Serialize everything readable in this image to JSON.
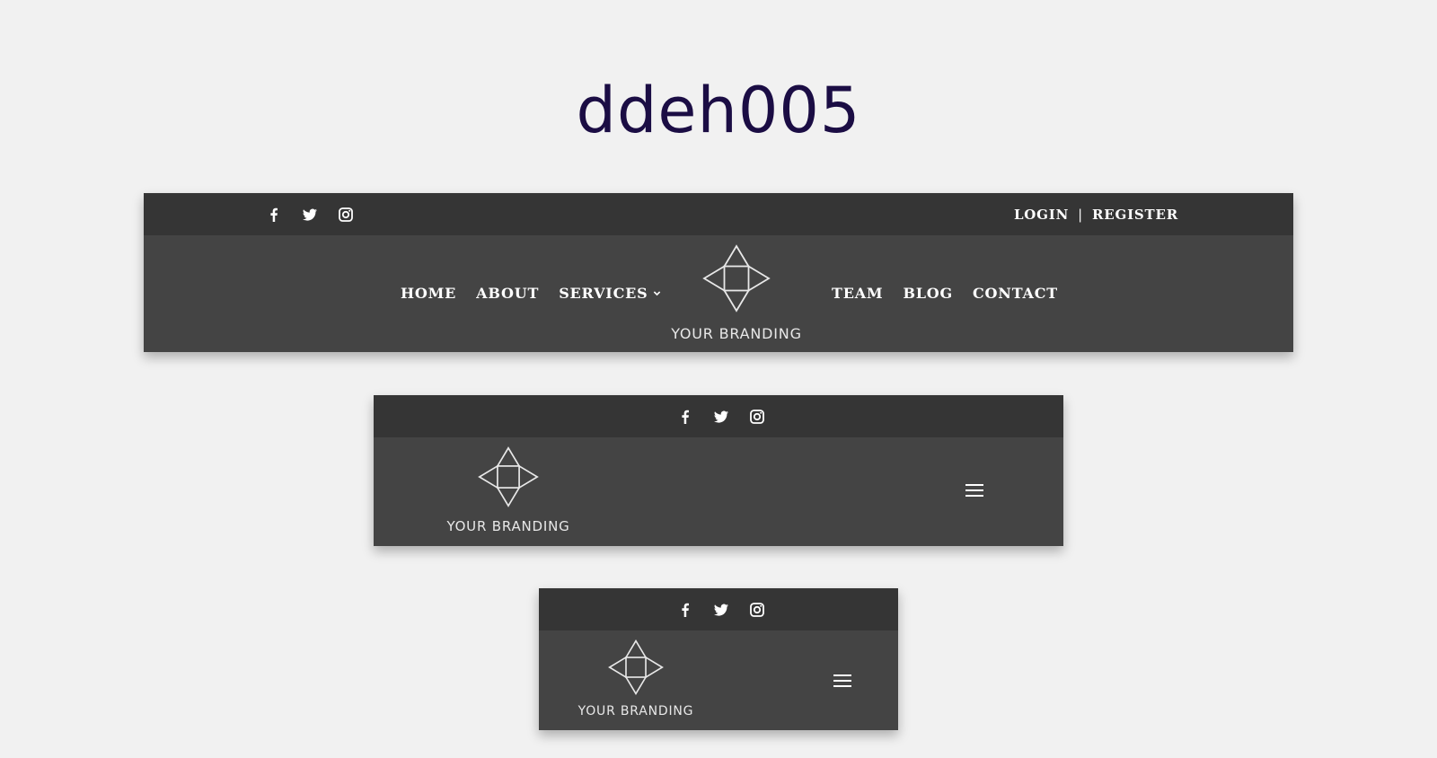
{
  "page": {
    "title": "ddeh005"
  },
  "brand": {
    "name": "YOUR BRANDING"
  },
  "social": {
    "icons": [
      "facebook-icon",
      "twitter-icon",
      "instagram-icon"
    ]
  },
  "desktop": {
    "auth": {
      "login": "LOGIN",
      "separator": "|",
      "register": "REGISTER"
    },
    "nav_left": [
      {
        "label": "HOME"
      },
      {
        "label": "ABOUT"
      },
      {
        "label": "SERVICES",
        "has_dropdown": true
      }
    ],
    "nav_right": [
      {
        "label": "TEAM"
      },
      {
        "label": "BLOG"
      },
      {
        "label": "CONTACT"
      }
    ]
  },
  "colors": {
    "page_bg": "#f1f1f1",
    "title": "#1b0d44",
    "top_bar": "#353535",
    "main_bar": "#444444",
    "text": "#ffffff"
  }
}
